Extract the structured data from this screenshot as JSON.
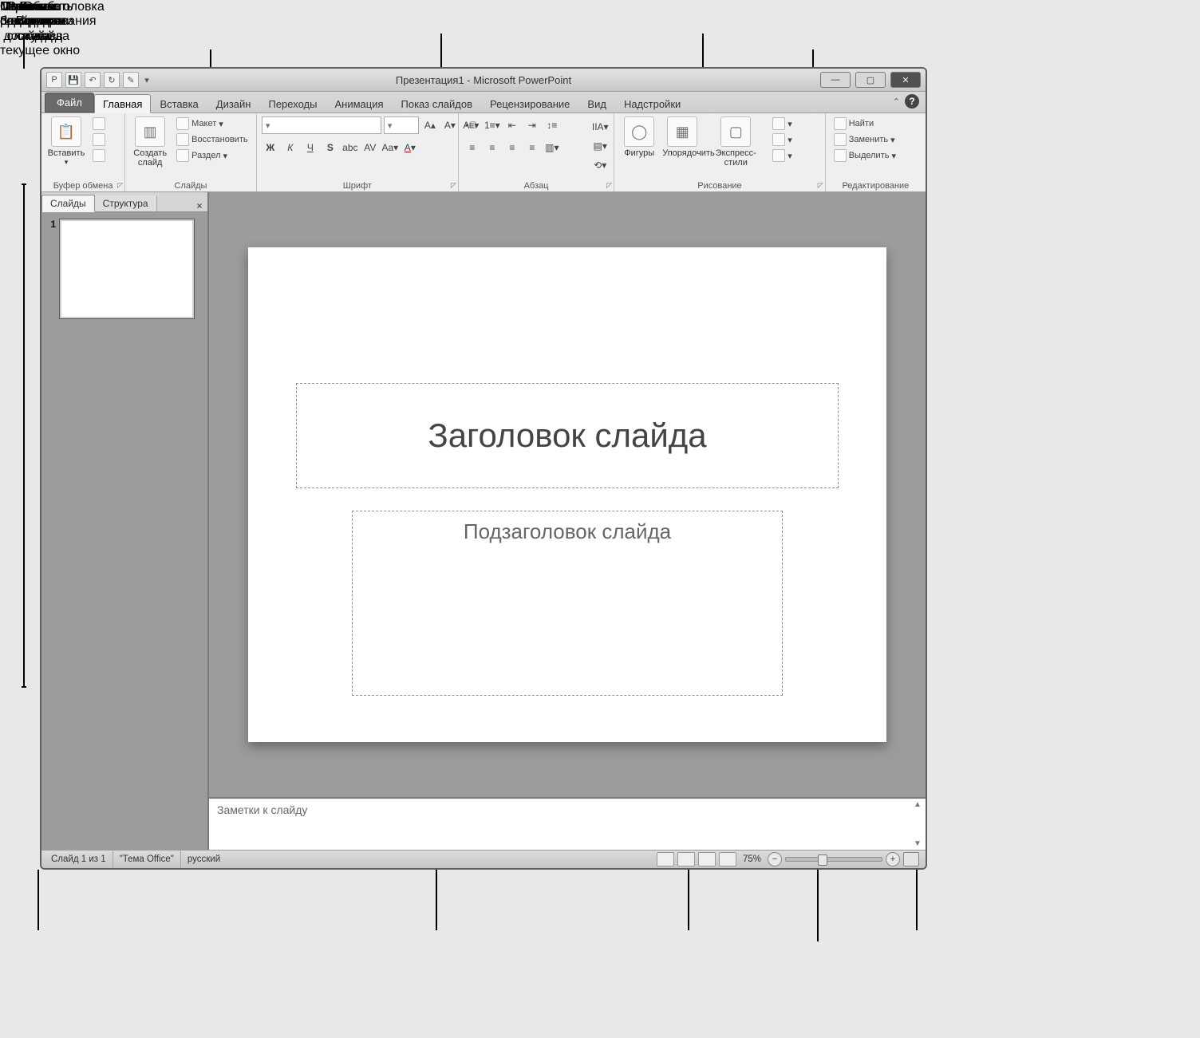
{
  "callouts": {
    "slides_pane": "Панель\nслайдов",
    "qat": "Панель\nбыстрого\nдоступа",
    "titlebar": "Строка заголовка\nокна",
    "ribbon": "Лента\nс вкладками",
    "edit_area": "Область\nредактирования\nслайда",
    "statusbar": "Строка\nсостояния",
    "notes": "Панель\nЗаметки",
    "view_modes": "Режимы\nпросмотра\nслайдов",
    "zoom": "Масштаб",
    "fit": "Кнопка\nВписать\nслайд в\nтекущее окно"
  },
  "window": {
    "title": "Презентация1  -  Microsoft PowerPoint",
    "tabs": {
      "file": "Файл",
      "items": [
        "Главная",
        "Вставка",
        "Дизайн",
        "Переходы",
        "Анимация",
        "Показ слайдов",
        "Рецензирование",
        "Вид",
        "Надстройки"
      ],
      "active_index": 0
    }
  },
  "ribbon": {
    "clipboard": {
      "label": "Буфер обмена",
      "paste": "Вставить"
    },
    "slides": {
      "label": "Слайды",
      "new": "Создать\nслайд",
      "layout": "Макет",
      "reset": "Восстановить",
      "section": "Раздел"
    },
    "font": {
      "label": "Шрифт"
    },
    "paragraph": {
      "label": "Абзац"
    },
    "drawing": {
      "label": "Рисование",
      "shapes": "Фигуры",
      "arrange": "Упорядочить",
      "styles": "Экспресс-стили"
    },
    "editing": {
      "label": "Редактирование",
      "find": "Найти",
      "replace": "Заменить",
      "select": "Выделить"
    }
  },
  "pane": {
    "tabs": {
      "slides": "Слайды",
      "outline": "Структура"
    },
    "thumbnails": [
      {
        "num": "1"
      }
    ]
  },
  "slide": {
    "title_placeholder": "Заголовок слайда",
    "subtitle_placeholder": "Подзаголовок слайда"
  },
  "notes": {
    "placeholder": "Заметки к слайду"
  },
  "status": {
    "slide_of": "Слайд 1 из 1",
    "theme": "\"Тема Office\"",
    "lang": "русский",
    "zoom": "75%"
  }
}
